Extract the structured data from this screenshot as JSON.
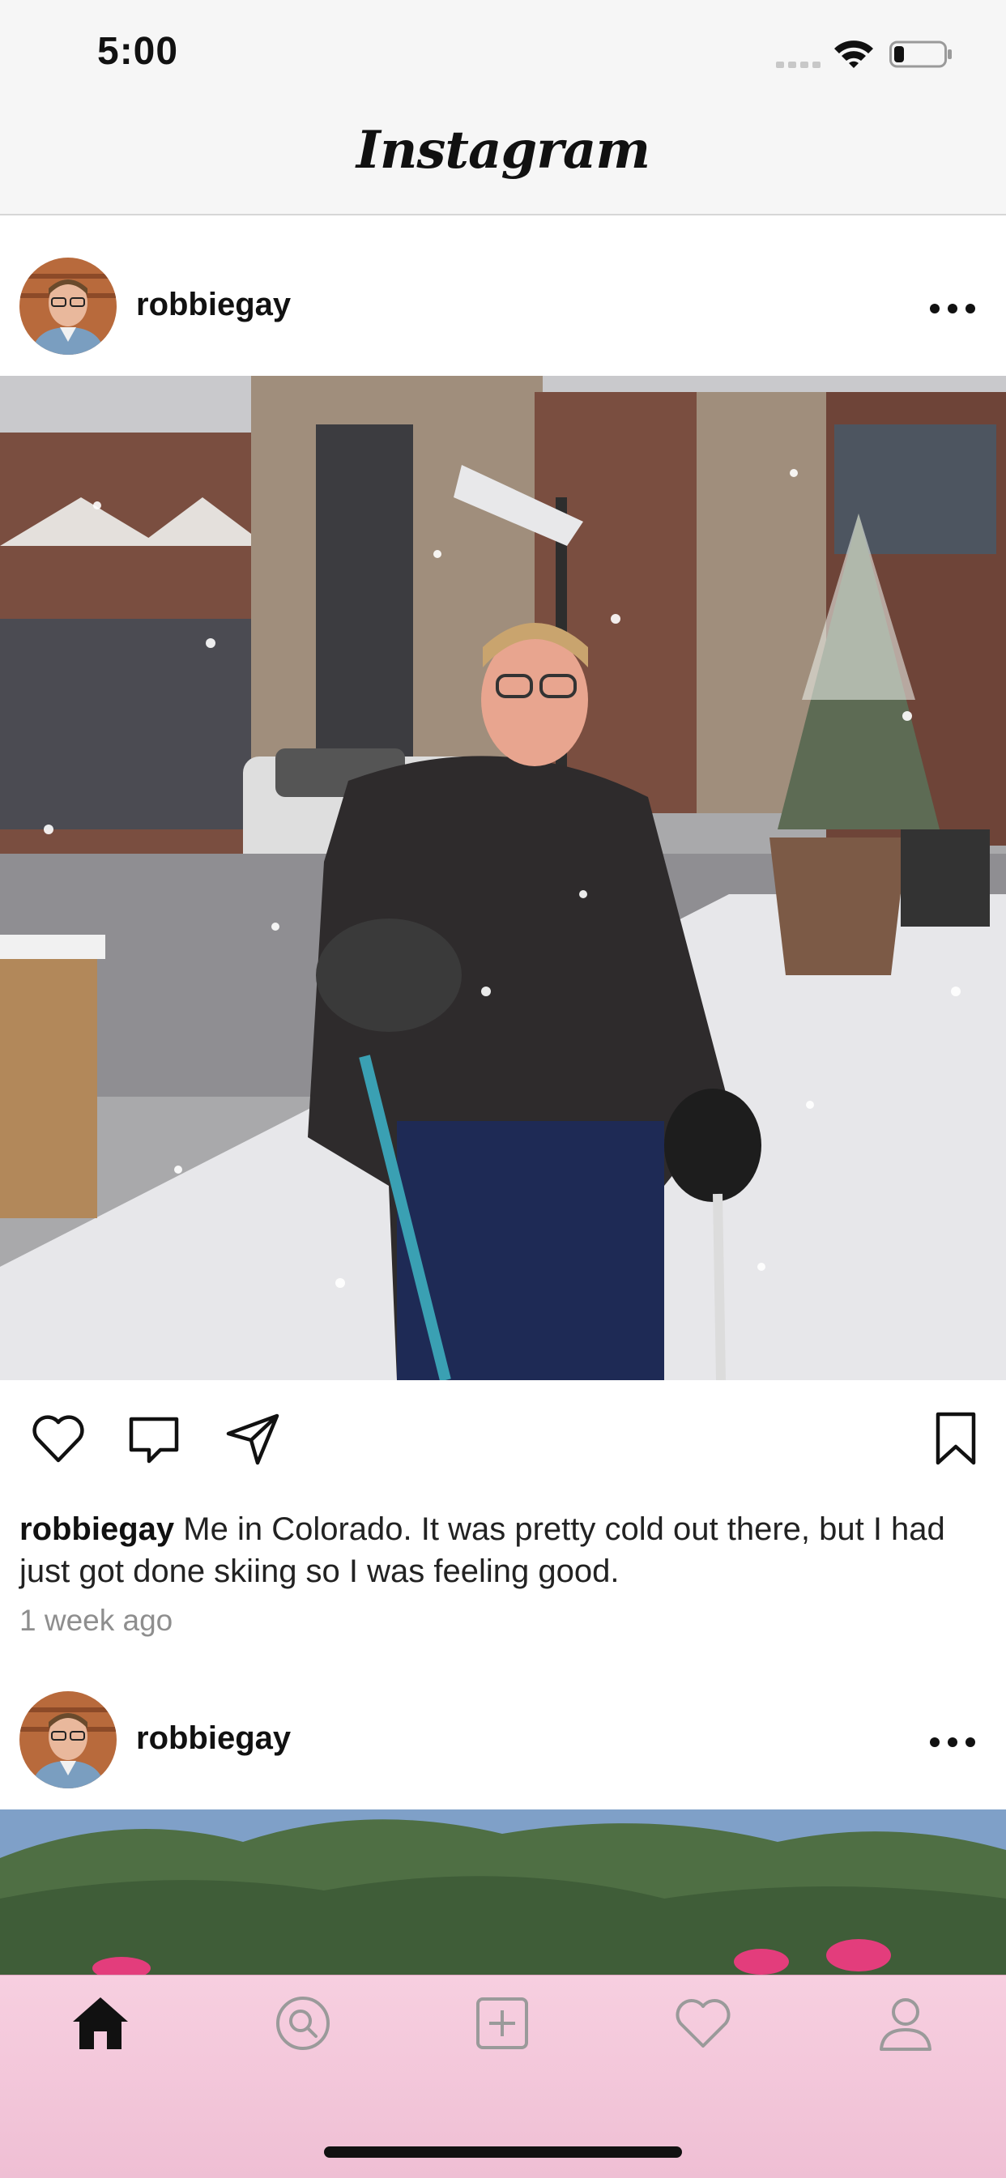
{
  "status_bar": {
    "time": "5:00",
    "battery_level": 0.2
  },
  "header": {
    "title": "Instagram"
  },
  "posts": [
    {
      "username": "robbiegay",
      "caption": "Me in Colorado. It was pretty cold out there, but I had just got done skiing so I was feeling good.",
      "timestamp": "1 week ago"
    },
    {
      "username": "robbiegay"
    }
  ],
  "tab_bar": {
    "items": [
      {
        "icon": "home-icon",
        "active": true
      },
      {
        "icon": "search-icon",
        "active": false
      },
      {
        "icon": "add-post-icon",
        "active": false
      },
      {
        "icon": "activity-heart-icon",
        "active": false
      },
      {
        "icon": "profile-icon",
        "active": false
      }
    ]
  }
}
